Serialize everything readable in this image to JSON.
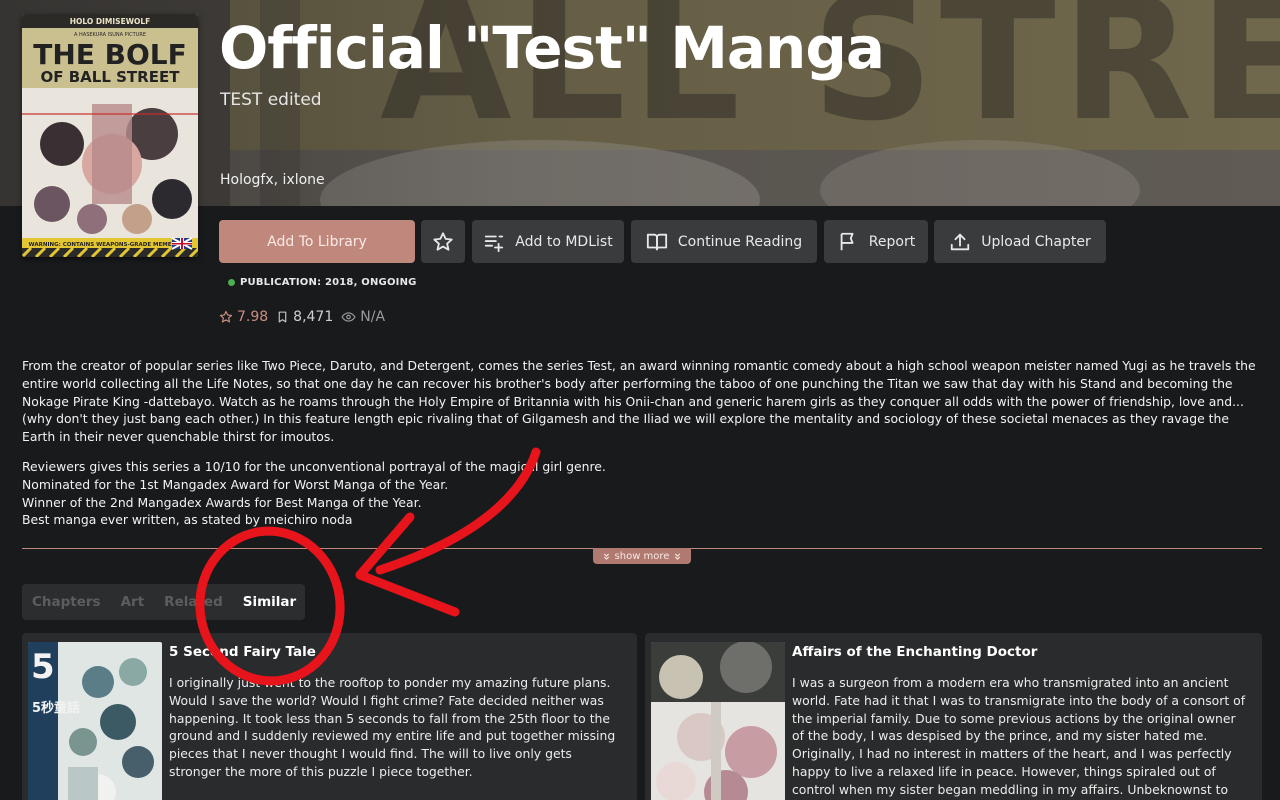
{
  "manga": {
    "title": "Official \"Test\" Manga",
    "alt_title": "TEST edited",
    "authors": "Hologfx, ixlone",
    "publication": "PUBLICATION: 2018, ONGOING",
    "publication_status_color": "#4caf50"
  },
  "cover": {
    "top_text": "HOLO DIMISEWOLF",
    "brand": "A HASEKURA ISUNA PICTURE",
    "title_line1": "THE BOLF",
    "title_line2": "OF BALL STREET",
    "warning": "WARNING: CONTAINS WEAPONS-GRADE MEMES"
  },
  "actions": {
    "add_to_library": "Add To Library",
    "add_to_mdlist": "Add to MDList",
    "continue_reading": "Continue Reading",
    "report": "Report",
    "upload_chapter": "Upload Chapter"
  },
  "stats": {
    "rating": "7.98",
    "follows": "8,471",
    "views": "N/A"
  },
  "description": {
    "paragraph1": "From the creator of popular series like Two Piece, Daruto, and Detergent, comes the series Test, an award winning romantic comedy about a high school weapon meister named Yugi as he travels the entire world collecting all the Life Notes, so that one day he can recover his brother's body after performing the taboo of one punching the Titan we saw that day with his Stand and becoming the Nokage Pirate King -dattebayo. Watch as he roams through the Holy Empire of Britannia with his Onii-chan and generic harem girls as they conquer all odds with the power of friendship, love and... (why don't they just bang each other.) In this feature length epic rivaling that of Gilgamesh and the Iliad we will explore the mentality and sociology of these societal menaces as they ravage the Earth in their never quenchable thirst for imoutos.",
    "line1": "Reviewers gives this series a 10/10 for the unconventional portrayal of the magical girl genre.",
    "line2": "Nominated for the 1st Mangadex Award for Worst Manga of the Year.",
    "line3": "Winner of the 2nd Mangadex Awards for Best Manga of the Year.",
    "line4": "Best manga ever written, as stated by meichiro noda",
    "show_more": "show more"
  },
  "tabs": {
    "chapters": "Chapters",
    "art": "Art",
    "related": "Related",
    "similar": "Similar"
  },
  "similar": [
    {
      "title": "5 Second Fairy Tale",
      "description": "I originally just went to the rooftop to ponder my amazing future plans. Would I save the world? Would I fight crime? Fate decided neither was happening. It took less than 5 seconds to fall from the 25th floor to the ground and I suddenly reviewed my entire life and put together missing pieces that I never thought I would find. The will to live only gets stronger the more of this puzzle I piece together.",
      "thumb_text": "5秒童話"
    },
    {
      "title": "Affairs of the Enchanting Doctor",
      "description": "I was a surgeon from a modern era who transmigrated into an ancient world. Fate had it that I was to transmigrate into the body of a consort of the imperial family. Due to some previous actions by the original owner of the body, I was despised by the prince, and my sister hated me. Originally, I had no interest in matters of the heart, and I was perfectly happy to live a relaxed life in peace. However, things spiraled out of control when my sister began meddling in my affairs. Unbeknownst to everyone around me,"
    }
  ],
  "colors": {
    "accent": "#c0877c",
    "background": "#191a1c",
    "button": "#3a3b3d",
    "annotation": "#e8141b"
  }
}
